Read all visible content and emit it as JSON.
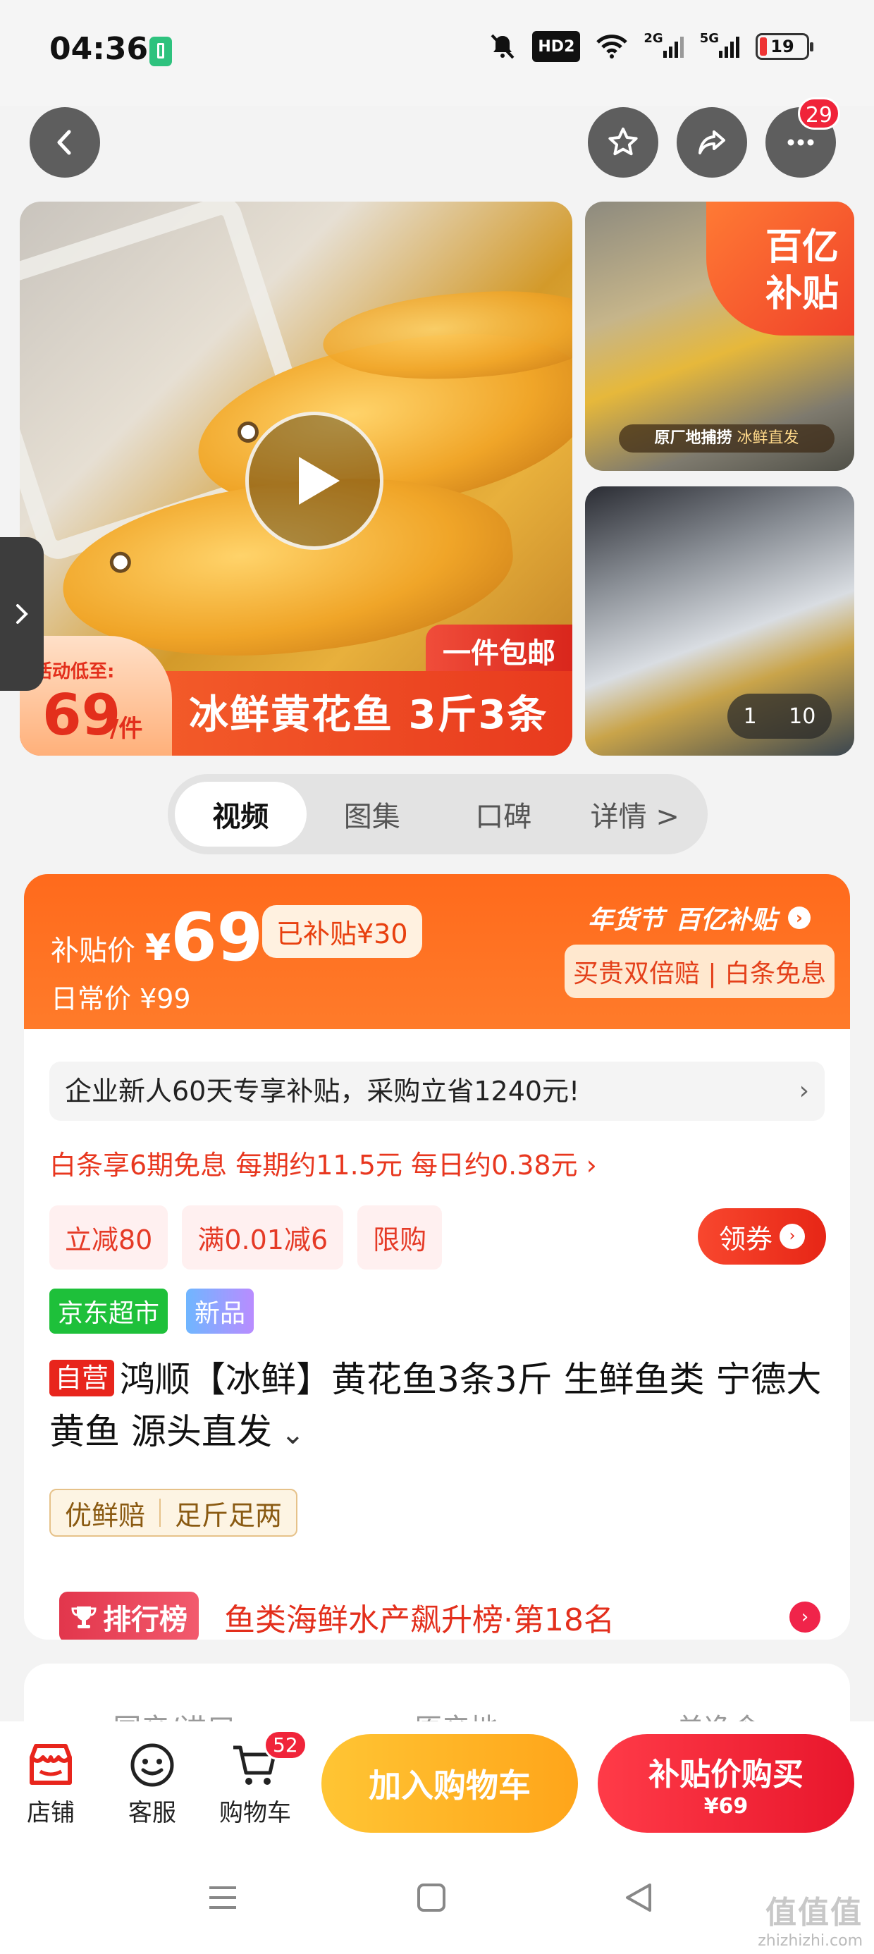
{
  "status_bar": {
    "time": "04:36",
    "hd_label": "HD2",
    "net_2g": "2G",
    "net_5g": "5G",
    "battery": "19"
  },
  "nav": {
    "message_count": "29"
  },
  "gallery": {
    "low_price_label": "活动低至:",
    "low_price_value": "69",
    "low_price_unit": "/件",
    "banner_title": "冰鲜黄花鱼 3斤3条",
    "free_shipping": "一件包邮",
    "thumb1_ribbon_line1": "百亿",
    "thumb1_ribbon_line2": "补贴",
    "thumb1_caption_bold": "原厂地捕捞",
    "thumb1_caption_rest": "冰鲜直发",
    "counter_current": "1",
    "counter_total": "10"
  },
  "media_tabs": [
    {
      "label": "视频",
      "active": true
    },
    {
      "label": "图集",
      "active": false
    },
    {
      "label": "口碑",
      "active": false
    },
    {
      "label": "详情 >",
      "active": false
    }
  ],
  "price": {
    "label": "补贴价",
    "currency": "¥",
    "value": "69",
    "subsidized": "已补贴¥30",
    "daily_price": "日常价 ¥99",
    "festival": "年货节",
    "program": "百亿补贴",
    "promo_pill": "买贵双倍赔 | 白条免息"
  },
  "offers": {
    "notice": "企业新人60天专享补贴，采购立省1240元!",
    "installment": "白条享6期免息 每期约11.5元 每日约0.38元 ›",
    "chips": [
      "立减80",
      "满0.01减6",
      "限购"
    ],
    "coupon_button": "领券"
  },
  "product": {
    "store_tag": "京东超市",
    "new_tag": "新品",
    "self_tag": "自营",
    "title": "鸿顺【冰鲜】黄花鱼3条3斤 生鲜鱼类 宁德大黄鱼 源头直发",
    "guarantees": [
      "优鲜赔",
      "足斤足两"
    ],
    "rank_badge": "排行榜",
    "rank_text": "鱼类海鲜水产飙升榜·第18名"
  },
  "spec_row": [
    "国产/进口",
    "原产地",
    "单净含"
  ],
  "bottom_bar": {
    "store_label": "店铺",
    "service_label": "客服",
    "cart_label": "购物车",
    "cart_count": "52",
    "add_to_cart": "加入购物车",
    "buy_line1": "补贴价购买",
    "buy_line2": "¥69"
  },
  "watermark": {
    "brand": "值值值",
    "domain": "zhizhizhi.com"
  },
  "colors": {
    "accent_orange": "#ff6a1c",
    "price_red": "#e32f1c",
    "buy_red": "#e8162c",
    "cart_yellow": "#ffb020"
  }
}
